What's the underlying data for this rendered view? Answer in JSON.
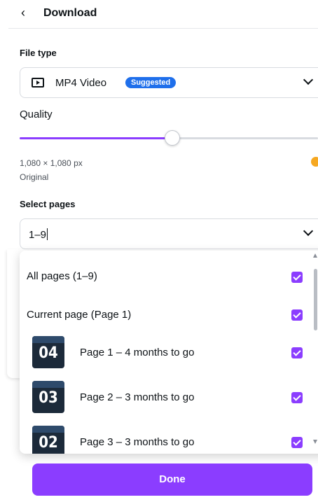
{
  "header": {
    "back_icon": "chevron-left-icon",
    "title": "Download"
  },
  "file_type": {
    "label": "File type",
    "icon": "video-play-icon",
    "value": "MP4 Video",
    "badge": "Suggested",
    "badge_color": "#1f6feb"
  },
  "quality": {
    "label": "Quality",
    "slider_fraction": 0.51,
    "dimensions": "1,080 × 1,080 px",
    "note": "Original",
    "accent": "#8b3dff"
  },
  "select_pages": {
    "label": "Select pages",
    "value": "1–9",
    "options": [
      {
        "label": "All pages (1–9)",
        "checked": true
      },
      {
        "label": "Current page (Page 1)",
        "checked": true
      },
      {
        "thumb": "04",
        "label": "Page 1 – 4 months to go",
        "checked": true
      },
      {
        "thumb": "03",
        "label": "Page 2 – 3 months to go",
        "checked": true
      },
      {
        "thumb": "02",
        "label": "Page 3 – 3 months to go",
        "checked": true
      }
    ]
  },
  "done_button": "Done"
}
